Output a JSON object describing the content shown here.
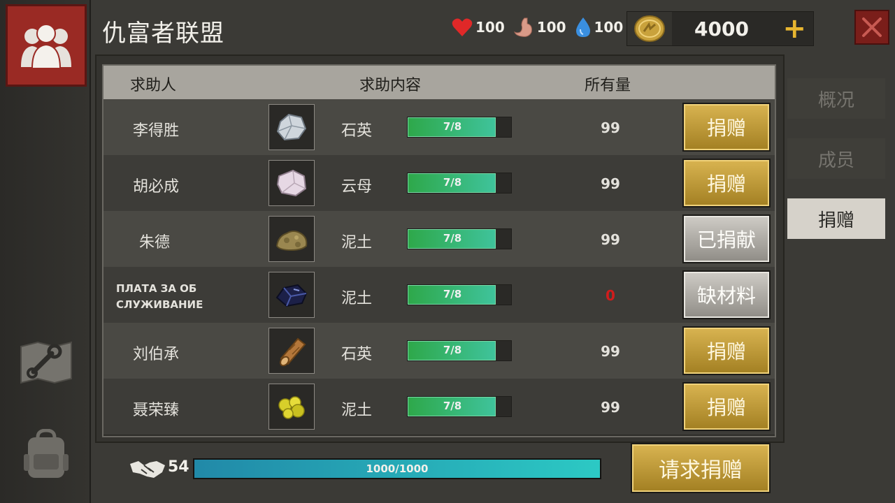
{
  "header": {
    "title": "仇富者联盟",
    "stats": [
      {
        "icon": "heart-icon",
        "value": "100",
        "color": "#e02828"
      },
      {
        "icon": "stomach-icon",
        "value": "100",
        "color": "#d99a88"
      },
      {
        "icon": "water-drop-icon",
        "value": "100",
        "color": "#3a8fe0"
      }
    ],
    "currency": {
      "icon": "coin-icon",
      "value": "4000",
      "plus_label": "+"
    },
    "close_label": "✕"
  },
  "tabs": [
    {
      "label": "概况",
      "active": false
    },
    {
      "label": "成员",
      "active": false
    },
    {
      "label": "捐赠",
      "active": true
    }
  ],
  "table": {
    "headers": {
      "requester": "求助人",
      "content": "求助内容",
      "owned": "所有量"
    },
    "rows": [
      {
        "name": "李得胜",
        "icon": "quartz-icon",
        "item": "石英",
        "progress": "7/8",
        "progress_ratio": 0.875,
        "owned": "99",
        "action": "捐赠",
        "action_style": "gold"
      },
      {
        "name": "胡必成",
        "icon": "mica-icon",
        "item": "云母",
        "progress": "7/8",
        "progress_ratio": 0.875,
        "owned": "99",
        "action": "捐赠",
        "action_style": "gold"
      },
      {
        "name": "朱德",
        "icon": "dirt-icon",
        "item": "泥土",
        "progress": "7/8",
        "progress_ratio": 0.875,
        "owned": "99",
        "action": "已捐献",
        "action_style": "grey"
      },
      {
        "name_line1": "ПЛАТА ЗА ОБ",
        "name_line2": "СЛУЖИВАНИЕ",
        "icon": "ore-icon",
        "item": "泥土",
        "progress": "7/8",
        "progress_ratio": 0.875,
        "owned": "0",
        "action": "缺材料",
        "action_style": "grey"
      },
      {
        "name": "刘伯承",
        "icon": "wood-log-icon",
        "item": "石英",
        "progress": "7/8",
        "progress_ratio": 0.875,
        "owned": "99",
        "action": "捐赠",
        "action_style": "gold"
      },
      {
        "name": "聂荣臻",
        "icon": "sulfur-icon",
        "item": "泥土",
        "progress": "7/8",
        "progress_ratio": 0.875,
        "owned": "99",
        "action": "捐赠",
        "action_style": "gold"
      }
    ]
  },
  "footer": {
    "friend_count": "54",
    "contribution": "1000/1000",
    "contribution_ratio": 1.0,
    "request_button": "请求捐赠"
  },
  "sidebar": {
    "items": [
      {
        "icon": "guild-members-icon",
        "active": true
      },
      {
        "icon": "map-wrench-icon",
        "active": false
      },
      {
        "icon": "backpack-icon",
        "active": false
      }
    ]
  },
  "colors": {
    "accent_gold": "#c9a23c",
    "alert_red": "#d01c1c",
    "progress_green": "#2ea84a",
    "contribution_teal": "#2cc9c4"
  }
}
